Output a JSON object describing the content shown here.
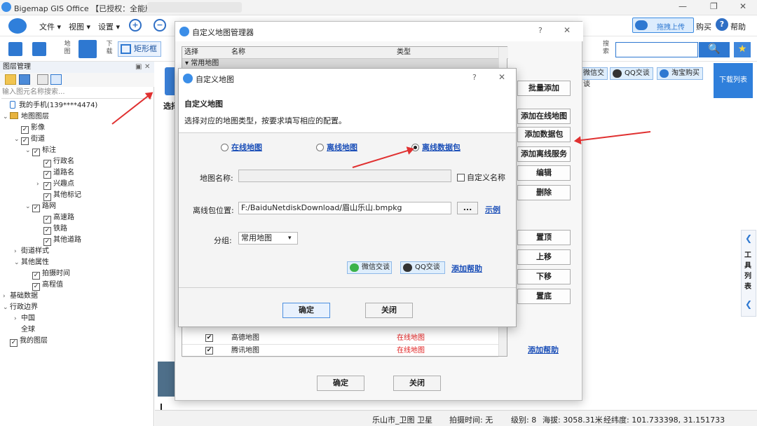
{
  "app": {
    "title": "Bigemap GIS Office 【已授权：全能版】"
  },
  "topright": {
    "upload": "拖拽上传",
    "buy": "购买",
    "help": "帮助"
  },
  "menu": {
    "file": "文件 ▾",
    "view": "视图 ▾",
    "settings": "设置 ▾"
  },
  "toolbar": {
    "map_label": "地图",
    "download_label": "下载",
    "rect": "矩形框",
    "search_label": "搜索",
    "search_btn": "🔍",
    "star": "★"
  },
  "layer_panel": {
    "title": "图层管理",
    "search_placeholder": "输入图元名称搜索...",
    "items": [
      {
        "text": "我的手机(139****4474)",
        "indent": 0,
        "exp": "",
        "cb": "phone"
      },
      {
        "text": "地图图层",
        "indent": 0,
        "exp": "⌄",
        "cb": "layer"
      },
      {
        "text": "影像",
        "indent": 1,
        "exp": "",
        "cb": "on"
      },
      {
        "text": "街道",
        "indent": 1,
        "exp": "⌄",
        "cb": "on"
      },
      {
        "text": "标注",
        "indent": 2,
        "exp": "⌄",
        "cb": "on"
      },
      {
        "text": "行政名",
        "indent": 3,
        "exp": "",
        "cb": "on"
      },
      {
        "text": "道路名",
        "indent": 3,
        "exp": "",
        "cb": "on"
      },
      {
        "text": "兴趣点",
        "indent": 3,
        "exp": "›",
        "cb": "on"
      },
      {
        "text": "其他标记",
        "indent": 3,
        "exp": "",
        "cb": "on"
      },
      {
        "text": "路网",
        "indent": 2,
        "exp": "⌄",
        "cb": "on"
      },
      {
        "text": "高速路",
        "indent": 3,
        "exp": "",
        "cb": "on"
      },
      {
        "text": "铁路",
        "indent": 3,
        "exp": "",
        "cb": "on"
      },
      {
        "text": "其他道路",
        "indent": 3,
        "exp": "",
        "cb": "on"
      },
      {
        "text": "街道样式",
        "indent": 1,
        "exp": "›",
        "cb": "none"
      },
      {
        "text": "其他属性",
        "indent": 1,
        "exp": "⌄",
        "cb": "none"
      },
      {
        "text": "拍摄时间",
        "indent": 2,
        "exp": "",
        "cb": "on"
      },
      {
        "text": "高程值",
        "indent": 2,
        "exp": "",
        "cb": "on"
      },
      {
        "text": "基础数据",
        "indent": 0,
        "exp": "›",
        "cb": "none"
      },
      {
        "text": "行政边界",
        "indent": 0,
        "exp": "⌄",
        "cb": "none"
      },
      {
        "text": "中国",
        "indent": 1,
        "exp": "›",
        "cb": "none"
      },
      {
        "text": "全球",
        "indent": 1,
        "exp": "",
        "cb": "none"
      },
      {
        "text": "我的图层",
        "indent": 0,
        "exp": "",
        "cb": "on"
      }
    ]
  },
  "map_strip": {
    "select": "选择",
    "wechat": "微信交谈",
    "qq": "QQ交谈",
    "taobao": "淘宝购买",
    "download_list": "下载列表",
    "tools": "工具列表"
  },
  "status": {
    "place": "乐山市_卫图 卫星",
    "shot": "拍摄时间: 无",
    "level": "级别:  8",
    "elev": "海拔: 3058.31米",
    "lonlat": "经纬度:  101.733398, 31.151733"
  },
  "manager": {
    "title": "自定义地图管理器",
    "col_select": "选择",
    "col_name": "名称",
    "col_type": "类型",
    "group": "常用地图",
    "rows": [
      {
        "name": "高德地图",
        "type": "在线地图",
        "checked": "✔"
      },
      {
        "name": "腾讯地图",
        "type": "在线地图",
        "checked": "✔"
      }
    ],
    "buttons": [
      "批量添加",
      "添加在线地图",
      "添加数据包",
      "添加离线服务",
      "编辑",
      "删除",
      "置顶",
      "上移",
      "下移",
      "置底"
    ],
    "help": "添加帮助",
    "ok": "确定",
    "close": "关闭"
  },
  "custom": {
    "title": "自定义地图",
    "heading": "自定义地图",
    "desc": "选择对应的地图类型，按要求填写相应的配置。",
    "radios": [
      "在线地图",
      "离线地图",
      "离线数据包"
    ],
    "name_label": "地图名称:",
    "name_value": "",
    "custom_name": "自定义名称",
    "path_label": "离线包位置:",
    "path_value": "F:/BaiduNetdiskDownload/眉山乐山.bmpkg",
    "browse": "...",
    "example": "示例",
    "group_label": "分组:",
    "group_value": "常用地图",
    "wechat": "微信交谈",
    "qq": "QQ交谈",
    "help": "添加帮助",
    "ok": "确定",
    "close": "关闭"
  },
  "glyphs": {
    "help": "?",
    "close": "✕",
    "min": "—",
    "max": "❐",
    "arrow_left": "❮"
  }
}
